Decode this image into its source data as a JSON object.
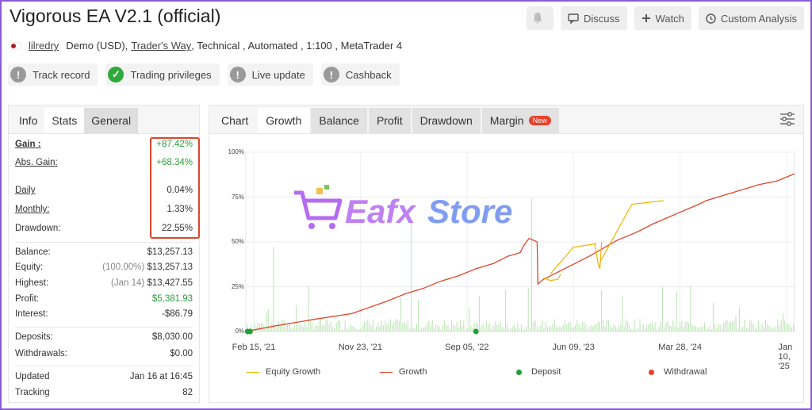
{
  "title": "Vigorous EA V2.1 (official)",
  "top_buttons": {
    "discuss": "Discuss",
    "watch": "Watch",
    "custom_analysis": "Custom Analysis"
  },
  "meta": {
    "user": "lilredry",
    "account_type": "Demo (USD),",
    "broker": "Trader's Way",
    "details": ", Technical , Automated , 1:100 , MetaTrader 4"
  },
  "pills": [
    "Track record",
    "Trading privileges",
    "Live update",
    "Cashback"
  ],
  "left_tabs": [
    "Info",
    "Stats",
    "General"
  ],
  "stats": {
    "gain": {
      "label": "Gain :",
      "value": "+87.42%"
    },
    "abs_gain": {
      "label": "Abs. Gain:",
      "value": "+68.34%"
    },
    "daily": {
      "label": "Daily",
      "value": "0.04%"
    },
    "monthly": {
      "label": "Monthly:",
      "value": "1.33%"
    },
    "drawdown": {
      "label": "Drawdown:",
      "value": "22.55%"
    },
    "balance": {
      "label": "Balance:",
      "value": "$13,257.13"
    },
    "equity": {
      "label": "Equity:",
      "note": "(100.00%)",
      "value": "$13,257.13"
    },
    "highest": {
      "label": "Highest:",
      "note": "(Jan 14)",
      "value": "$13,427.55"
    },
    "profit": {
      "label": "Profit:",
      "value": "$5,381.93"
    },
    "interest": {
      "label": "Interest:",
      "value": "-$86.79"
    },
    "deposits": {
      "label": "Deposits:",
      "value": "$8,030.00"
    },
    "withdrawals": {
      "label": "Withdrawals:",
      "value": "$0.00"
    },
    "updated": {
      "label": "Updated",
      "value": "Jan 16 at 16:45"
    },
    "tracking": {
      "label": "Tracking",
      "value": "82"
    }
  },
  "chart_tabs": {
    "chart": "Chart",
    "growth": "Growth",
    "balance": "Balance",
    "profit": "Profit",
    "drawdown": "Drawdown",
    "margin": "Margin",
    "new_badge": "New"
  },
  "watermark": {
    "a": "Eafx",
    "b": "Store"
  },
  "chart_data": {
    "type": "line",
    "ylim": [
      0,
      100
    ],
    "yticks": [
      "100%",
      "75%",
      "50%",
      "25%",
      "0%"
    ],
    "x_tick_labels": [
      "Feb 15, '21",
      "Nov 23, '21",
      "Sep 05, '22",
      "Jun 09, '23",
      "Mar 28, '24",
      "Jan 10, '25"
    ],
    "series": [
      {
        "name": "Growth",
        "color": "#e0442a",
        "points": [
          [
            0,
            0
          ],
          [
            0.08,
            3
          ],
          [
            0.2,
            7
          ],
          [
            0.3,
            10
          ],
          [
            0.4,
            17
          ],
          [
            0.45,
            21
          ],
          [
            0.5,
            24
          ],
          [
            0.55,
            28
          ],
          [
            0.6,
            31
          ],
          [
            0.65,
            35
          ],
          [
            0.7,
            38
          ],
          [
            0.74,
            42
          ],
          [
            0.775,
            44
          ],
          [
            0.785,
            48
          ],
          [
            0.8,
            52
          ],
          [
            0.823,
            50
          ],
          [
            0.825,
            26.5
          ],
          [
            0.84,
            29
          ],
          [
            0.86,
            31
          ],
          [
            0.88,
            33
          ],
          [
            0.9,
            35
          ],
          [
            0.94,
            39
          ],
          [
            0.97,
            42
          ],
          [
            1.05,
            51
          ],
          [
            1.1,
            55
          ],
          [
            1.15,
            60
          ],
          [
            1.22,
            66
          ],
          [
            1.28,
            71
          ],
          [
            1.3,
            73
          ],
          [
            1.35,
            76
          ],
          [
            1.4,
            79
          ],
          [
            1.45,
            82
          ],
          [
            1.5,
            84
          ],
          [
            1.55,
            88
          ]
        ]
      },
      {
        "name": "Equity Growth",
        "color": "#f0b400",
        "dips": [
          [
            0.86,
            29
          ],
          [
            0.99,
            47
          ],
          [
            1.001,
            36
          ],
          [
            1.18,
            71
          ],
          [
            1.19,
            68
          ]
        ]
      },
      {
        "name": "Deposit",
        "color": "#1ea33a",
        "points": [
          [
            0.005,
            0
          ],
          [
            0.012,
            0
          ],
          [
            0.65,
            0
          ]
        ]
      },
      {
        "name": "Withdrawal",
        "color": "#e8412c",
        "points": []
      }
    ]
  }
}
